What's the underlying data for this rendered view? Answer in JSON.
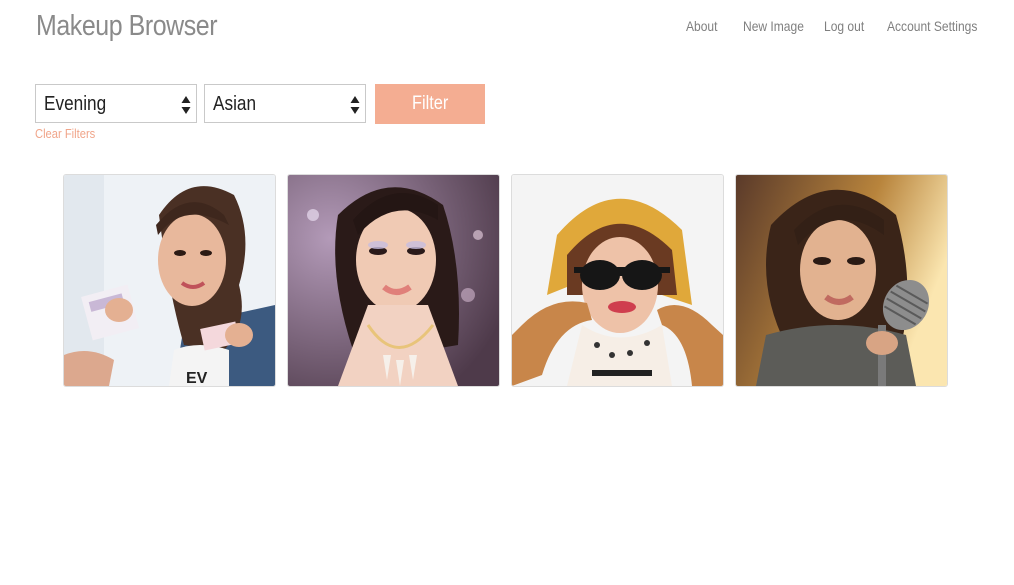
{
  "header": {
    "brand": "Makeup Browser",
    "nav": {
      "about": "About",
      "new_image": "New Image",
      "log_out": "Log out",
      "account_settings": "Account Settings"
    }
  },
  "filters": {
    "occasion_value": "Evening",
    "ethnicity_value": "Asian",
    "filter_button": "Filter",
    "clear_filters": "Clear Filters"
  },
  "colors": {
    "accent": "#f4ad92",
    "link_accent": "#f0a58a",
    "brand_text": "#8a8a8a"
  },
  "gallery": [
    {
      "kind": "photo"
    },
    {
      "kind": "photo"
    },
    {
      "kind": "photo"
    },
    {
      "kind": "photo"
    }
  ]
}
